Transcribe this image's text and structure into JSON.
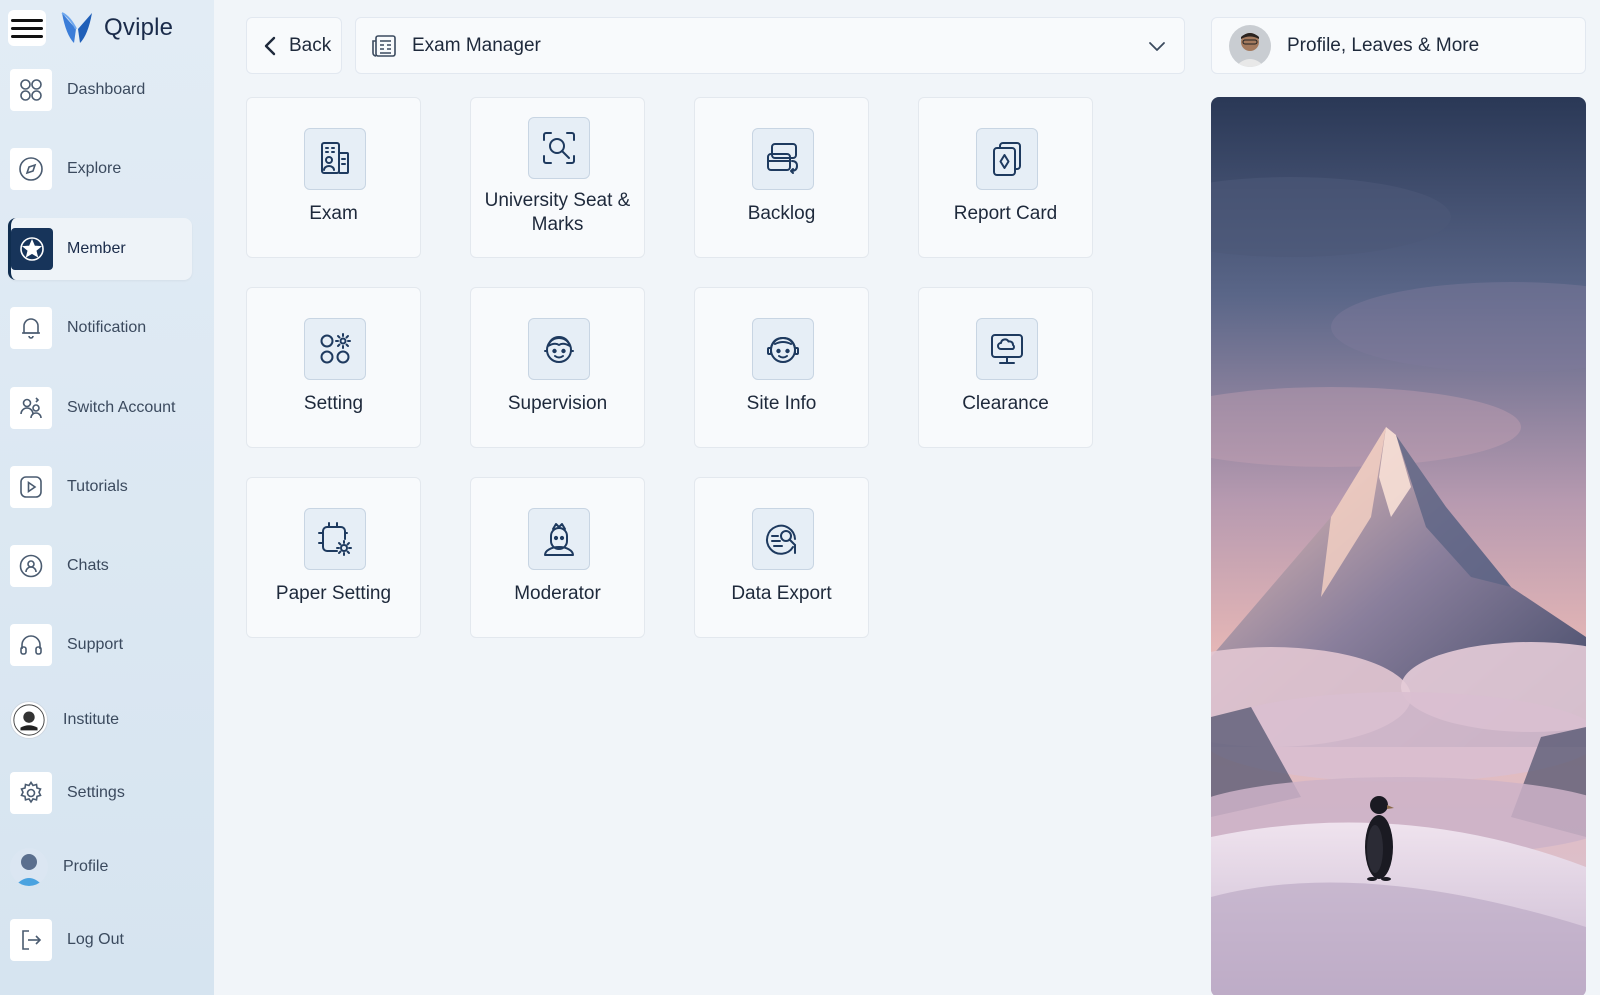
{
  "brand": {
    "name": "Qviple"
  },
  "sidebar": {
    "items": [
      {
        "label": "Dashboard",
        "icon": "dashboard-grid-icon"
      },
      {
        "label": "Explore",
        "icon": "compass-icon"
      },
      {
        "label": "Member",
        "icon": "member-badge-icon",
        "active": true
      },
      {
        "label": "Notification",
        "icon": "bell-icon"
      },
      {
        "label": "Switch Account",
        "icon": "switch-account-icon"
      },
      {
        "label": "Tutorials",
        "icon": "play-icon"
      },
      {
        "label": "Chats",
        "icon": "chat-icon"
      },
      {
        "label": "Support",
        "icon": "headphones-icon"
      },
      {
        "label": "Institute",
        "icon": "institute-avatar"
      },
      {
        "label": "Settings",
        "icon": "gear-icon"
      },
      {
        "label": "Profile",
        "icon": "profile-avatar"
      },
      {
        "label": "Log Out",
        "icon": "logout-icon"
      }
    ]
  },
  "topbar": {
    "back_label": "Back",
    "module_label": "Exam Manager",
    "profile_label": "Profile, Leaves & More"
  },
  "tiles": [
    {
      "label": "Exam",
      "icon": "exam-icon"
    },
    {
      "label": "University Seat & Marks",
      "icon": "seat-search-icon"
    },
    {
      "label": "Backlog",
      "icon": "backlog-icon"
    },
    {
      "label": "Report Card",
      "icon": "report-card-icon"
    },
    {
      "label": "Setting",
      "icon": "setting-apps-icon"
    },
    {
      "label": "Supervision",
      "icon": "supervision-icon"
    },
    {
      "label": "Site Info",
      "icon": "site-info-icon"
    },
    {
      "label": "Clearance",
      "icon": "clearance-icon"
    },
    {
      "label": "Paper Setting",
      "icon": "paper-setting-icon"
    },
    {
      "label": "Moderator",
      "icon": "moderator-icon"
    },
    {
      "label": "Data Export",
      "icon": "data-export-icon"
    }
  ],
  "hero": {
    "image": "mountain-penguin-image"
  },
  "colors": {
    "accent": "#17345a",
    "icon_stroke": "#1e3a5f",
    "tile_icon_bg": "#e6eef6"
  }
}
